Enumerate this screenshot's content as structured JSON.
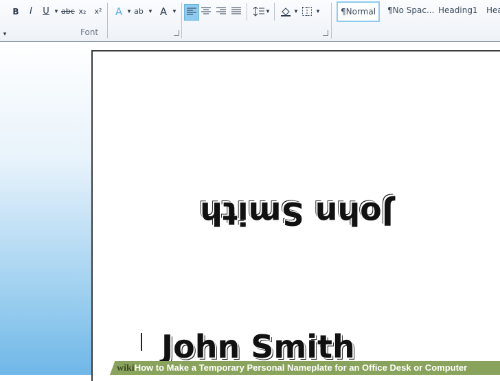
{
  "ribbon": {
    "font_buttons": [
      "B",
      "I",
      "U",
      "abc",
      "x₂",
      "x²"
    ],
    "font_group_label": "Font",
    "misc_glyphs": [
      "A",
      "ab",
      "A"
    ],
    "styles": [
      "¶Normal",
      "¶No Spac...",
      "Heading1",
      "Hea"
    ]
  },
  "document": {
    "name_flipped": "John Smith",
    "name": "John Smith"
  },
  "caption": {
    "wiki": "wiki",
    "how": "How",
    "text": " to Make a Temporary Personal Nameplate for an Office Desk or Computer"
  },
  "colors": {
    "selected_align": "#8ecbf0",
    "caption_bar": "#8aa35c"
  }
}
